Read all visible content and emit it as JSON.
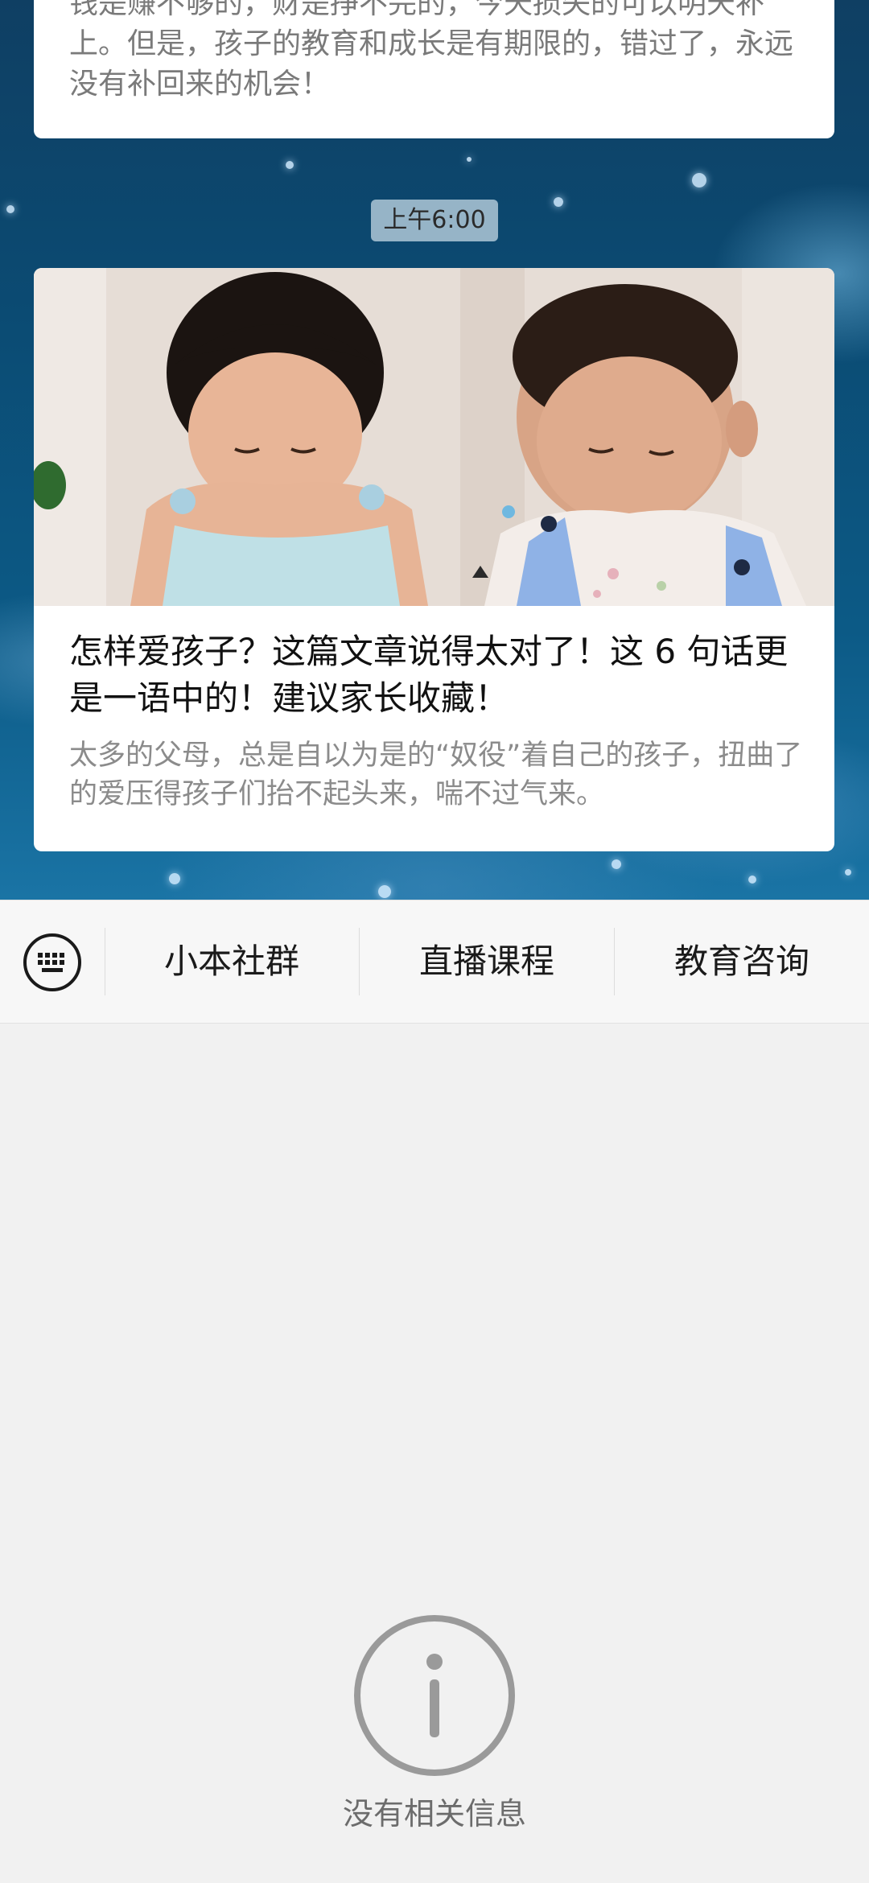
{
  "chat": {
    "prev_message_text": "钱是赚不够的，财是挣不完的，今天损失的可以明天补上。但是，孩子的教育和成长是有期限的，错过了，永远没有补回来的机会！",
    "timestamp": "上午6:00",
    "article": {
      "title": "怎样爱孩子？这篇文章说得太对了！这 6 句话更是一语中的！建议家长收藏！",
      "description": "太多的父母，总是自以为是的“奴役”着自己的孩子，扭曲了的爱压得孩子们抬不起头来，喘不过气来。",
      "image_icon": "photo-of-two-children"
    }
  },
  "menu": {
    "keyboard_icon": "keyboard-icon",
    "items": [
      {
        "label": "小本社群"
      },
      {
        "label": "直播课程"
      },
      {
        "label": "教育咨询"
      }
    ]
  },
  "empty_state": {
    "icon": "info-icon",
    "text": "没有相关信息"
  },
  "colors": {
    "chat_background": "#0b4b73",
    "menu_background": "#f7f7f7",
    "panel_background": "#f1f1f1",
    "info_icon": "#9a9a9a"
  }
}
